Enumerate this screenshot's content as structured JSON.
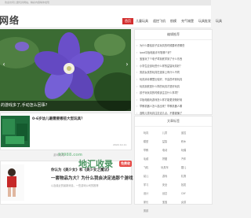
{
  "topbar": {
    "text": "欢迎访问儿童玩具网站，精彩内容等你发现"
  },
  "logo": {
    "text": "网络",
    "accent": "络"
  },
  "nav": {
    "items": [
      "首页",
      "儿童玩具",
      "遥控飞机",
      "航模",
      "充气城堡",
      "玩具批发",
      "玩具"
    ]
  },
  "hero": {
    "caption": "的游戏多了,手动怎么回事?",
    "prev": "‹",
    "next": "›"
  },
  "sidebar": {
    "recommend_title": "编辑推荐",
    "recommend": [
      "为什么要给孩子买玩具的时候要考虑哪些",
      "ipad平板电脑手写笔哪个好？",
      "宝宝玩了个电子琴到底学到了什么东西",
      "小学生应该玩些什么样的益智玩具好？",
      "男孩女孩的玩具在选择上有什么不同",
      "玩具消毒哪里比较好，不会损坏到玩具",
      "玩具到底是什么样的玩具才是好玩具",
      "孩子玩玩具的时候该注意什么事项？",
      "平板电脑玩游戏怎么样才能更流畅好用",
      "早教机器人怎么选出来？早教机器人哪",
      "选购儿童玩具注意这几点，不要被骗了"
    ],
    "tags_title": "文章标签",
    "tags": [
      "玩具",
      "儿童",
      "遥控",
      "模型",
      "益智",
      "积木",
      "早教",
      "电动",
      "玩偶",
      "毛绒",
      "拼图",
      "汽车",
      "飞机",
      "玩具车",
      "婴儿",
      "幼儿",
      "游戏",
      "礼物",
      "学习",
      "安全",
      "批发",
      "设计",
      "创意",
      "DIY",
      "家长",
      "宝宝",
      "女孩",
      "男孩"
    ]
  },
  "article1": {
    "title": "0-6岁幼儿最需要哪些大型玩具？",
    "meta": "2022-12-11"
  },
  "article2": {
    "title": "你认为《美少女》和《美少女之魔法》",
    "title2": "一套物品为大？为什么我会决定选那个游戏",
    "title3": "以及最近的最新消息，一些游戏公司的推荐",
    "meta": "原创"
  },
  "section": {
    "label": "游戏攻略"
  },
  "watermark": {
    "brand": "地汇收录",
    "url": "97988.com",
    "badge": "免费收"
  },
  "colors": {
    "accent": "#d32f2f",
    "hero": "#2f5d2a",
    "flower": "#6a4fc9"
  }
}
